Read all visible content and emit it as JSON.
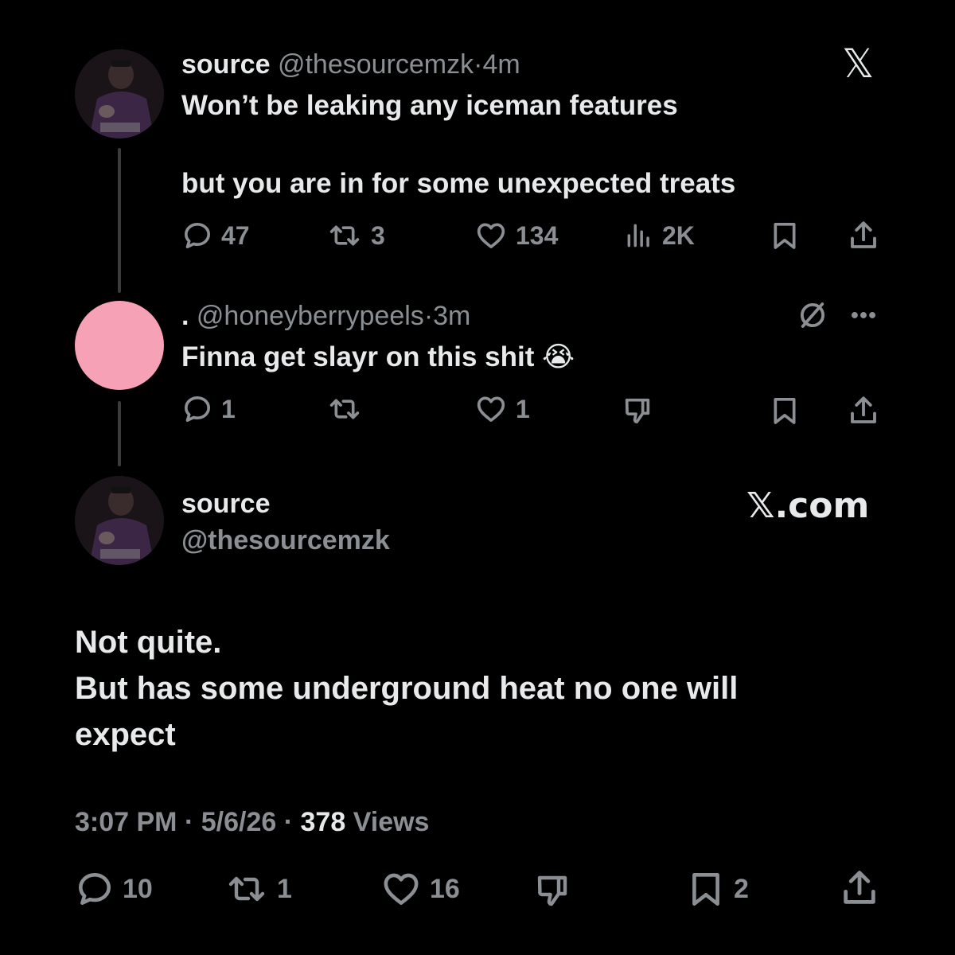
{
  "tweet1": {
    "display_name": "source",
    "handle": "@thesourcemzk",
    "separator": "·",
    "time": "4m",
    "line1": "Won’t be leaking any iceman features",
    "line2": "but you are in for some unexpected treats",
    "actions": {
      "replies": "47",
      "reposts": "3",
      "likes": "134",
      "views": "2K"
    }
  },
  "reply": {
    "display_name": ".",
    "handle": "@honeyberrypeels",
    "separator": "·",
    "time": "3m",
    "text": "Finna get slayr on this shit",
    "emoji": "😭",
    "avatar_color": "#f7a1b6",
    "actions": {
      "replies": "1",
      "likes": "1"
    }
  },
  "main": {
    "display_name": "source",
    "handle": "@thesourcemzk",
    "brand": "𝕏.com",
    "line1": "Not quite.",
    "line2": "But has some underground heat no one will",
    "line3": "expect",
    "meta": {
      "time": "3:07 PM",
      "sep1": "·",
      "date": "5/6/26",
      "sep2": "·",
      "views_count": "378",
      "views_label": "Views"
    },
    "actions": {
      "replies": "10",
      "reposts": "1",
      "likes": "16",
      "bookmarks": "2"
    }
  },
  "x_logo": "𝕏",
  "colors": {
    "background": "#000000",
    "text": "#e7e9ea",
    "muted": "#8b8f93",
    "thread_line": "#3b3b3b"
  }
}
